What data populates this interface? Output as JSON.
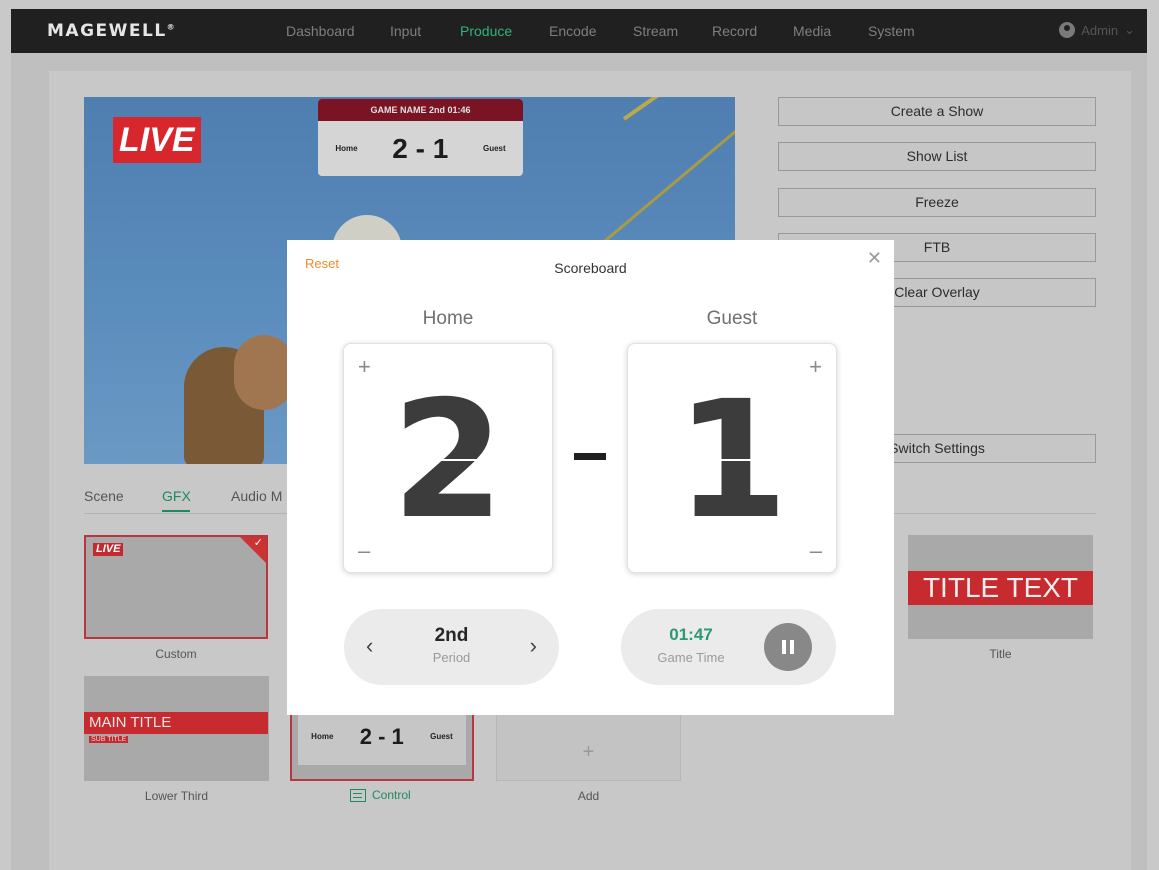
{
  "app": {
    "logo": "MAGEWELL",
    "nav": [
      {
        "label": "Dashboard",
        "active": false
      },
      {
        "label": "Input",
        "active": false
      },
      {
        "label": "Produce",
        "active": true
      },
      {
        "label": "Encode",
        "active": false
      },
      {
        "label": "Stream",
        "active": false
      },
      {
        "label": "Record",
        "active": false
      },
      {
        "label": "Media",
        "active": false
      },
      {
        "label": "System",
        "active": false
      }
    ],
    "user": "Admin"
  },
  "preview": {
    "live_tag": "LIVE",
    "scoreboard_overlay": {
      "header": "GAME NAME  2nd  01:46",
      "home": "Home",
      "score": "2 - 1",
      "guest": "Guest"
    }
  },
  "side_buttons": [
    "Create a Show",
    "Show List",
    "Freeze",
    "FTB",
    "Clear Overlay",
    "Switch Settings"
  ],
  "tabs": [
    {
      "label": "Scene",
      "active": false
    },
    {
      "label": "GFX",
      "active": true
    },
    {
      "label": "Audio M",
      "active": false
    }
  ],
  "gfx_cards": {
    "custom": {
      "label": "Custom",
      "live_tag": "LIVE"
    },
    "title": {
      "label": "Title",
      "text": "TITLE TEXT"
    },
    "lower_third": {
      "label": "Lower Third",
      "main_title": "MAIN TITLE",
      "sub_title": "SUB TITLE"
    },
    "control": {
      "label": "Control",
      "home": "Home",
      "score": "2 - 1",
      "guest": "Guest"
    },
    "add": {
      "label": "Add"
    }
  },
  "modal": {
    "title": "Scoreboard",
    "reset": "Reset",
    "home_label": "Home",
    "guest_label": "Guest",
    "home_score": "2",
    "guest_score": "1",
    "period_value": "2nd",
    "period_label": "Period",
    "game_time_value": "01:47",
    "game_time_label": "Game Time"
  },
  "colors": {
    "accent": "#2fb37c",
    "reset": "#f08a26",
    "live_red": "#d8262d"
  }
}
